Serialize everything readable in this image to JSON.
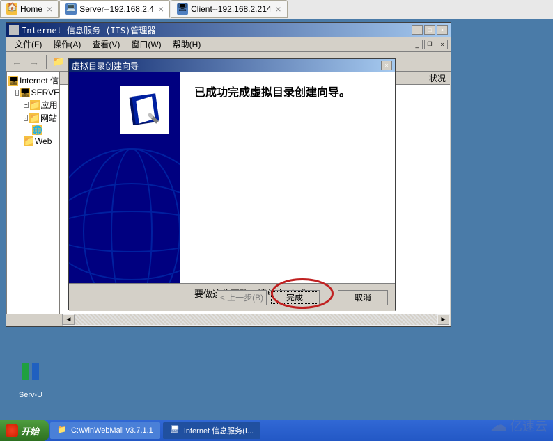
{
  "browserTabs": {
    "items": [
      {
        "label": "Home",
        "icon": "home-icon"
      },
      {
        "label": "Server--192.168.2.4",
        "icon": "server-icon"
      },
      {
        "label": "Client--192.168.2.214",
        "icon": "client-icon"
      }
    ]
  },
  "iisWindow": {
    "title": "Internet 信息服务 (IIS)管理器",
    "menus": {
      "file": "文件(F)",
      "action": "操作(A)",
      "view": "查看(V)",
      "window": "窗口(W)",
      "help": "帮助(H)"
    },
    "tree": {
      "root": "Internet 信",
      "server": "SERVER",
      "appPool": "应用",
      "website": "网站",
      "web": "Web"
    },
    "rightHeader": "状况"
  },
  "wizard": {
    "title": "虚拟目录创建向导",
    "heading": "已成功完成虚拟目录创建向导。",
    "instruction": "要做这些更改，请单击\"完成\"。",
    "buttons": {
      "back": "< 上一步(B)",
      "finish": "完成",
      "cancel": "取消"
    }
  },
  "desktopIcon": {
    "label": "Serv-U"
  },
  "taskbar": {
    "start": "开始",
    "items": [
      {
        "label": "C:\\WinWebMail v3.7.1.1"
      },
      {
        "label": "Internet 信息服务(I..."
      }
    ]
  },
  "watermark": {
    "text": "亿速云"
  }
}
